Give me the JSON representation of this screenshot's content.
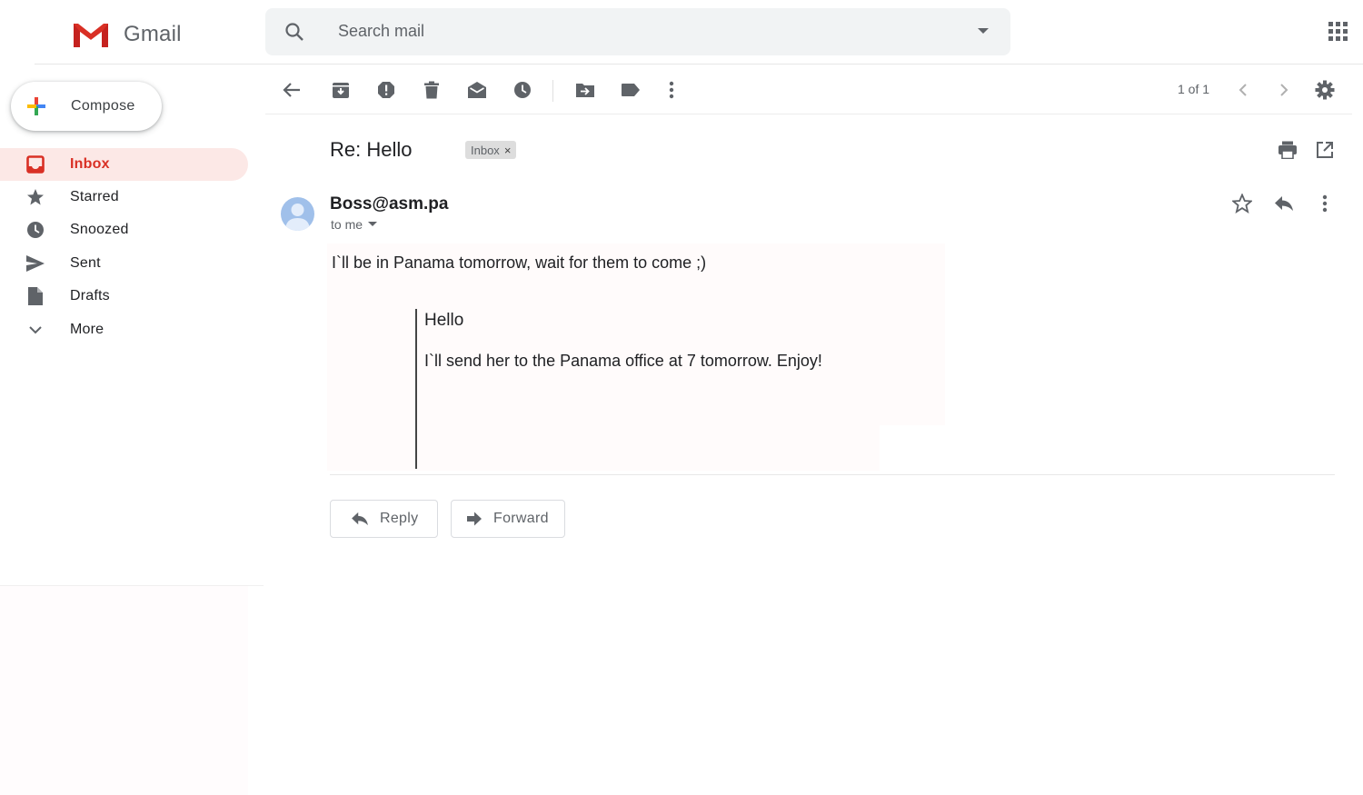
{
  "app": {
    "name": "Gmail"
  },
  "search": {
    "placeholder": "Search mail"
  },
  "compose": {
    "label": "Compose"
  },
  "sidebar": {
    "items": [
      {
        "label": "Inbox",
        "icon": "inbox-icon",
        "active": true
      },
      {
        "label": "Starred",
        "icon": "star-icon"
      },
      {
        "label": "Snoozed",
        "icon": "clock-icon"
      },
      {
        "label": "Sent",
        "icon": "send-icon"
      },
      {
        "label": "Drafts",
        "icon": "draft-icon"
      },
      {
        "label": "More",
        "icon": "chevron-down-icon"
      }
    ]
  },
  "toolbar": {
    "icons": [
      "back-arrow-icon",
      "archive-icon",
      "report-spam-icon",
      "delete-icon",
      "mark-unread-icon",
      "snooze-icon",
      "move-to-icon",
      "label-icon",
      "more-vert-icon"
    ],
    "page_count": "1 of 1"
  },
  "email": {
    "subject": "Re: Hello",
    "label_chip": "Inbox",
    "chip_close": "×",
    "sender": "Boss@asm.pa",
    "to": "to me",
    "body": "I`ll be in Panama tomorrow, wait for them to come ;)",
    "quote_title": "Hello",
    "quote_body": "I`ll send her to the Panama office at 7 tomorrow. Enjoy!"
  },
  "actions": {
    "reply": "Reply",
    "forward": "Forward"
  },
  "colors": {
    "accent": "#d93025",
    "active_bg": "#fce8e6",
    "search_bg": "#f1f3f4",
    "icon": "#5f6368"
  }
}
